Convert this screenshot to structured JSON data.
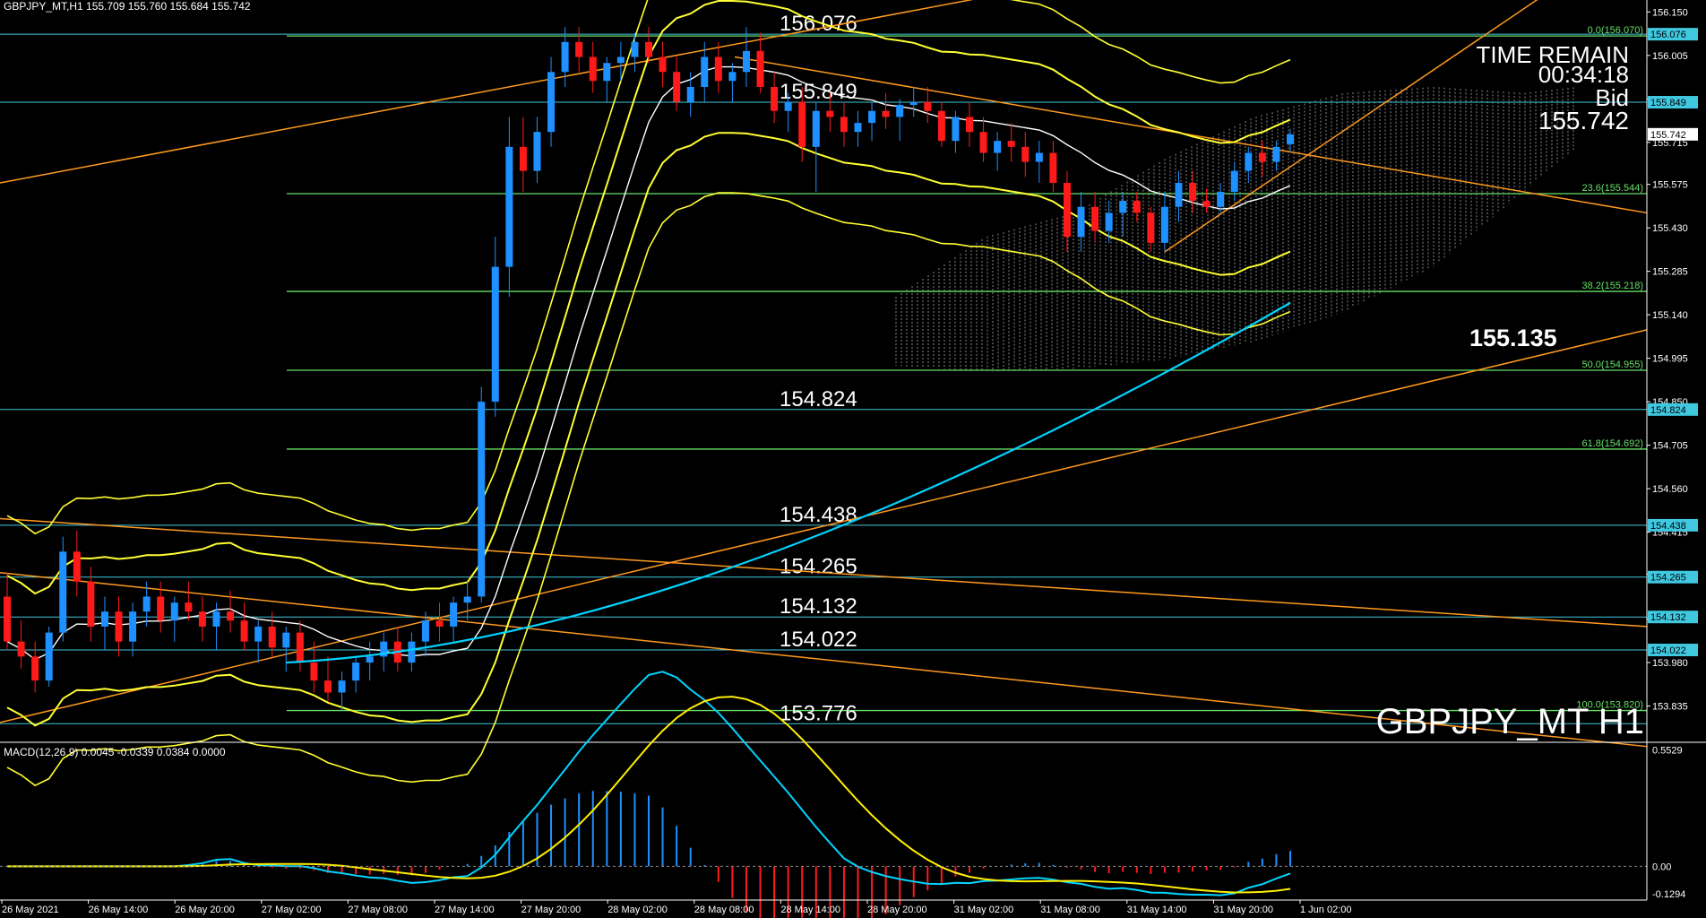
{
  "window": {
    "header": "GBPJPY_MT,H1  155.709 155.760 155.684 155.742",
    "symbol_watermark": "GBPJPY_MT H1"
  },
  "info_panel": {
    "time_remain_label": "TIME REMAIN",
    "time_remain_value": "00:34:18",
    "bid_label": "Bid",
    "bid_value": "155.742"
  },
  "colors": {
    "background": "#000000",
    "bull_candle": "#1e90ff",
    "bear_candle": "#ff1a1a",
    "level_line": "#40c8e0",
    "fib_line": "#66e066",
    "bollinger": "#ffff33",
    "trendline": "#ff9a1f",
    "ema_line": "#00d4ff",
    "macd_main": "#00d4ff",
    "macd_signal": "#ffee00"
  },
  "chart_data": {
    "type": "candlestick",
    "symbol": "GBPJPY_MT",
    "timeframe": "H1",
    "ohlc_current": {
      "open": 155.709,
      "high": 155.76,
      "low": 155.684,
      "close": 155.742
    },
    "y_axis": {
      "range": [
        153.72,
        156.19
      ],
      "ticks": [
        "156.150",
        "156.005",
        "155.860",
        "155.715",
        "155.575",
        "155.430",
        "155.285",
        "155.140",
        "154.995",
        "154.850",
        "154.705",
        "154.560",
        "154.415",
        "154.275",
        "154.125",
        "153.980",
        "153.835"
      ]
    },
    "x_axis": {
      "ticks": [
        "26 May 2021",
        "26 May 14:00",
        "26 May 20:00",
        "27 May 02:00",
        "27 May 08:00",
        "27 May 14:00",
        "27 May 20:00",
        "28 May 02:00",
        "28 May 08:00",
        "28 May 14:00",
        "28 May 20:00",
        "31 May 02:00",
        "31 May 08:00",
        "31 May 14:00",
        "31 May 20:00",
        "1 Jun 02:00"
      ]
    },
    "price_levels": [
      {
        "label": "156.076",
        "value": 156.076
      },
      {
        "label": "155.849",
        "value": 155.849
      },
      {
        "label": "154.824",
        "value": 154.824
      },
      {
        "label": "154.438",
        "value": 154.438
      },
      {
        "label": "154.265",
        "value": 154.265
      },
      {
        "label": "154.132",
        "value": 154.132
      },
      {
        "label": "154.022",
        "value": 154.022
      },
      {
        "label": "153.776",
        "value": 153.776
      }
    ],
    "axis_badges": [
      "156.076",
      "155.849",
      "155.742",
      "154.824",
      "154.438",
      "154.265",
      "154.132",
      "154.022"
    ],
    "fib_levels": [
      {
        "label": "0.0(156.070)",
        "value": 156.07
      },
      {
        "label": "23.6(155.544)",
        "value": 155.544
      },
      {
        "label": "38.2(155.218)",
        "value": 155.218
      },
      {
        "label": "50.0(154.955)",
        "value": 154.955
      },
      {
        "label": "61.8(154.692)",
        "value": 154.692
      },
      {
        "label": "100.0(153.820)",
        "value": 153.82
      }
    ],
    "highlight_price": "155.135",
    "candles": [
      [
        154.2,
        154.28,
        154.02,
        154.05
      ],
      [
        154.05,
        154.12,
        153.96,
        154.0
      ],
      [
        154.0,
        154.05,
        153.88,
        153.92
      ],
      [
        153.92,
        154.1,
        153.9,
        154.08
      ],
      [
        154.08,
        154.4,
        154.05,
        154.35
      ],
      [
        154.35,
        154.42,
        154.2,
        154.25
      ],
      [
        154.25,
        154.3,
        154.05,
        154.1
      ],
      [
        154.1,
        154.2,
        154.02,
        154.15
      ],
      [
        154.15,
        154.2,
        154.0,
        154.05
      ],
      [
        154.05,
        154.18,
        154.0,
        154.15
      ],
      [
        154.15,
        154.25,
        154.1,
        154.2
      ],
      [
        154.2,
        154.25,
        154.08,
        154.12
      ],
      [
        154.12,
        154.2,
        154.05,
        154.18
      ],
      [
        154.18,
        154.25,
        154.12,
        154.15
      ],
      [
        154.15,
        154.2,
        154.05,
        154.1
      ],
      [
        154.1,
        154.18,
        154.02,
        154.15
      ],
      [
        154.15,
        154.22,
        154.08,
        154.12
      ],
      [
        154.12,
        154.18,
        154.02,
        154.05
      ],
      [
        154.05,
        154.12,
        153.98,
        154.1
      ],
      [
        154.1,
        154.15,
        154.0,
        154.03
      ],
      [
        154.03,
        154.1,
        153.95,
        154.08
      ],
      [
        154.08,
        154.12,
        153.95,
        153.98
      ],
      [
        153.98,
        154.05,
        153.88,
        153.92
      ],
      [
        153.92,
        154.0,
        153.85,
        153.88
      ],
      [
        153.88,
        153.95,
        153.82,
        153.92
      ],
      [
        153.92,
        154.0,
        153.88,
        153.98
      ],
      [
        153.98,
        154.05,
        153.92,
        154.0
      ],
      [
        154.0,
        154.08,
        153.95,
        154.05
      ],
      [
        154.05,
        154.1,
        153.95,
        153.98
      ],
      [
        153.98,
        154.08,
        153.95,
        154.05
      ],
      [
        154.05,
        154.15,
        154.0,
        154.12
      ],
      [
        154.12,
        154.18,
        154.05,
        154.1
      ],
      [
        154.1,
        154.2,
        154.05,
        154.18
      ],
      [
        154.18,
        154.25,
        154.12,
        154.2
      ],
      [
        154.2,
        154.9,
        154.18,
        154.85
      ],
      [
        154.85,
        155.4,
        154.8,
        155.3
      ],
      [
        155.3,
        155.8,
        155.2,
        155.7
      ],
      [
        155.7,
        155.8,
        155.55,
        155.62
      ],
      [
        155.62,
        155.8,
        155.58,
        155.75
      ],
      [
        155.75,
        156.0,
        155.7,
        155.95
      ],
      [
        155.95,
        156.1,
        155.9,
        156.05
      ],
      [
        156.05,
        156.1,
        155.95,
        156.0
      ],
      [
        156.0,
        156.05,
        155.88,
        155.92
      ],
      [
        155.92,
        156.0,
        155.85,
        155.98
      ],
      [
        155.98,
        156.05,
        155.92,
        156.0
      ],
      [
        156.0,
        156.08,
        155.95,
        156.05
      ],
      [
        156.05,
        156.1,
        155.98,
        156.0
      ],
      [
        156.0,
        156.05,
        155.9,
        155.95
      ],
      [
        155.95,
        156.0,
        155.82,
        155.85
      ],
      [
        155.85,
        155.95,
        155.8,
        155.9
      ],
      [
        155.9,
        156.05,
        155.85,
        156.0
      ],
      [
        156.0,
        156.05,
        155.88,
        155.92
      ],
      [
        155.92,
        155.98,
        155.85,
        155.95
      ],
      [
        155.95,
        156.1,
        155.9,
        156.02
      ],
      [
        156.02,
        156.08,
        155.88,
        155.9
      ],
      [
        155.9,
        155.95,
        155.78,
        155.82
      ],
      [
        155.82,
        155.88,
        155.75,
        155.85
      ],
      [
        155.85,
        155.9,
        155.65,
        155.7
      ],
      [
        155.7,
        155.85,
        155.55,
        155.82
      ],
      [
        155.82,
        155.88,
        155.75,
        155.8
      ],
      [
        155.8,
        155.85,
        155.7,
        155.75
      ],
      [
        155.75,
        155.82,
        155.7,
        155.78
      ],
      [
        155.78,
        155.85,
        155.72,
        155.82
      ],
      [
        155.82,
        155.88,
        155.76,
        155.8
      ],
      [
        155.8,
        155.86,
        155.72,
        155.84
      ],
      [
        155.84,
        155.9,
        155.8,
        155.85
      ],
      [
        155.85,
        155.9,
        155.78,
        155.82
      ],
      [
        155.82,
        155.85,
        155.7,
        155.72
      ],
      [
        155.72,
        155.82,
        155.68,
        155.8
      ],
      [
        155.8,
        155.85,
        155.7,
        155.75
      ],
      [
        155.75,
        155.8,
        155.65,
        155.68
      ],
      [
        155.68,
        155.75,
        155.62,
        155.72
      ],
      [
        155.72,
        155.78,
        155.65,
        155.7
      ],
      [
        155.7,
        155.75,
        155.6,
        155.65
      ],
      [
        155.65,
        155.72,
        155.58,
        155.68
      ],
      [
        155.68,
        155.72,
        155.55,
        155.58
      ],
      [
        155.58,
        155.62,
        155.35,
        155.4
      ],
      [
        155.4,
        155.55,
        155.35,
        155.5
      ],
      [
        155.5,
        155.55,
        155.38,
        155.42
      ],
      [
        155.42,
        155.52,
        155.38,
        155.48
      ],
      [
        155.48,
        155.55,
        155.4,
        155.52
      ],
      [
        155.52,
        155.55,
        155.45,
        155.48
      ],
      [
        155.48,
        155.5,
        155.35,
        155.38
      ],
      [
        155.38,
        155.55,
        155.35,
        155.5
      ],
      [
        155.5,
        155.62,
        155.45,
        155.58
      ],
      [
        155.58,
        155.62,
        155.48,
        155.52
      ],
      [
        155.52,
        155.56,
        155.48,
        155.5
      ],
      [
        155.5,
        155.58,
        155.48,
        155.55
      ],
      [
        155.55,
        155.65,
        155.52,
        155.62
      ],
      [
        155.62,
        155.7,
        155.58,
        155.68
      ],
      [
        155.68,
        155.72,
        155.6,
        155.65
      ],
      [
        155.65,
        155.72,
        155.62,
        155.7
      ],
      [
        155.709,
        155.76,
        155.684,
        155.742
      ]
    ],
    "indicator": {
      "name": "MACD(12,26,9)",
      "header": "MACD(12,26,9) 0.0045 -0.0339 0.0384 0.0000",
      "fast": 12,
      "slow": 26,
      "signal": 9,
      "values": [
        0.0045,
        -0.0339,
        0.0384,
        0.0
      ],
      "y_ticks": [
        "0.5529",
        "0.00",
        "-0.1294"
      ],
      "y_range": [
        -0.16,
        0.58
      ]
    }
  }
}
